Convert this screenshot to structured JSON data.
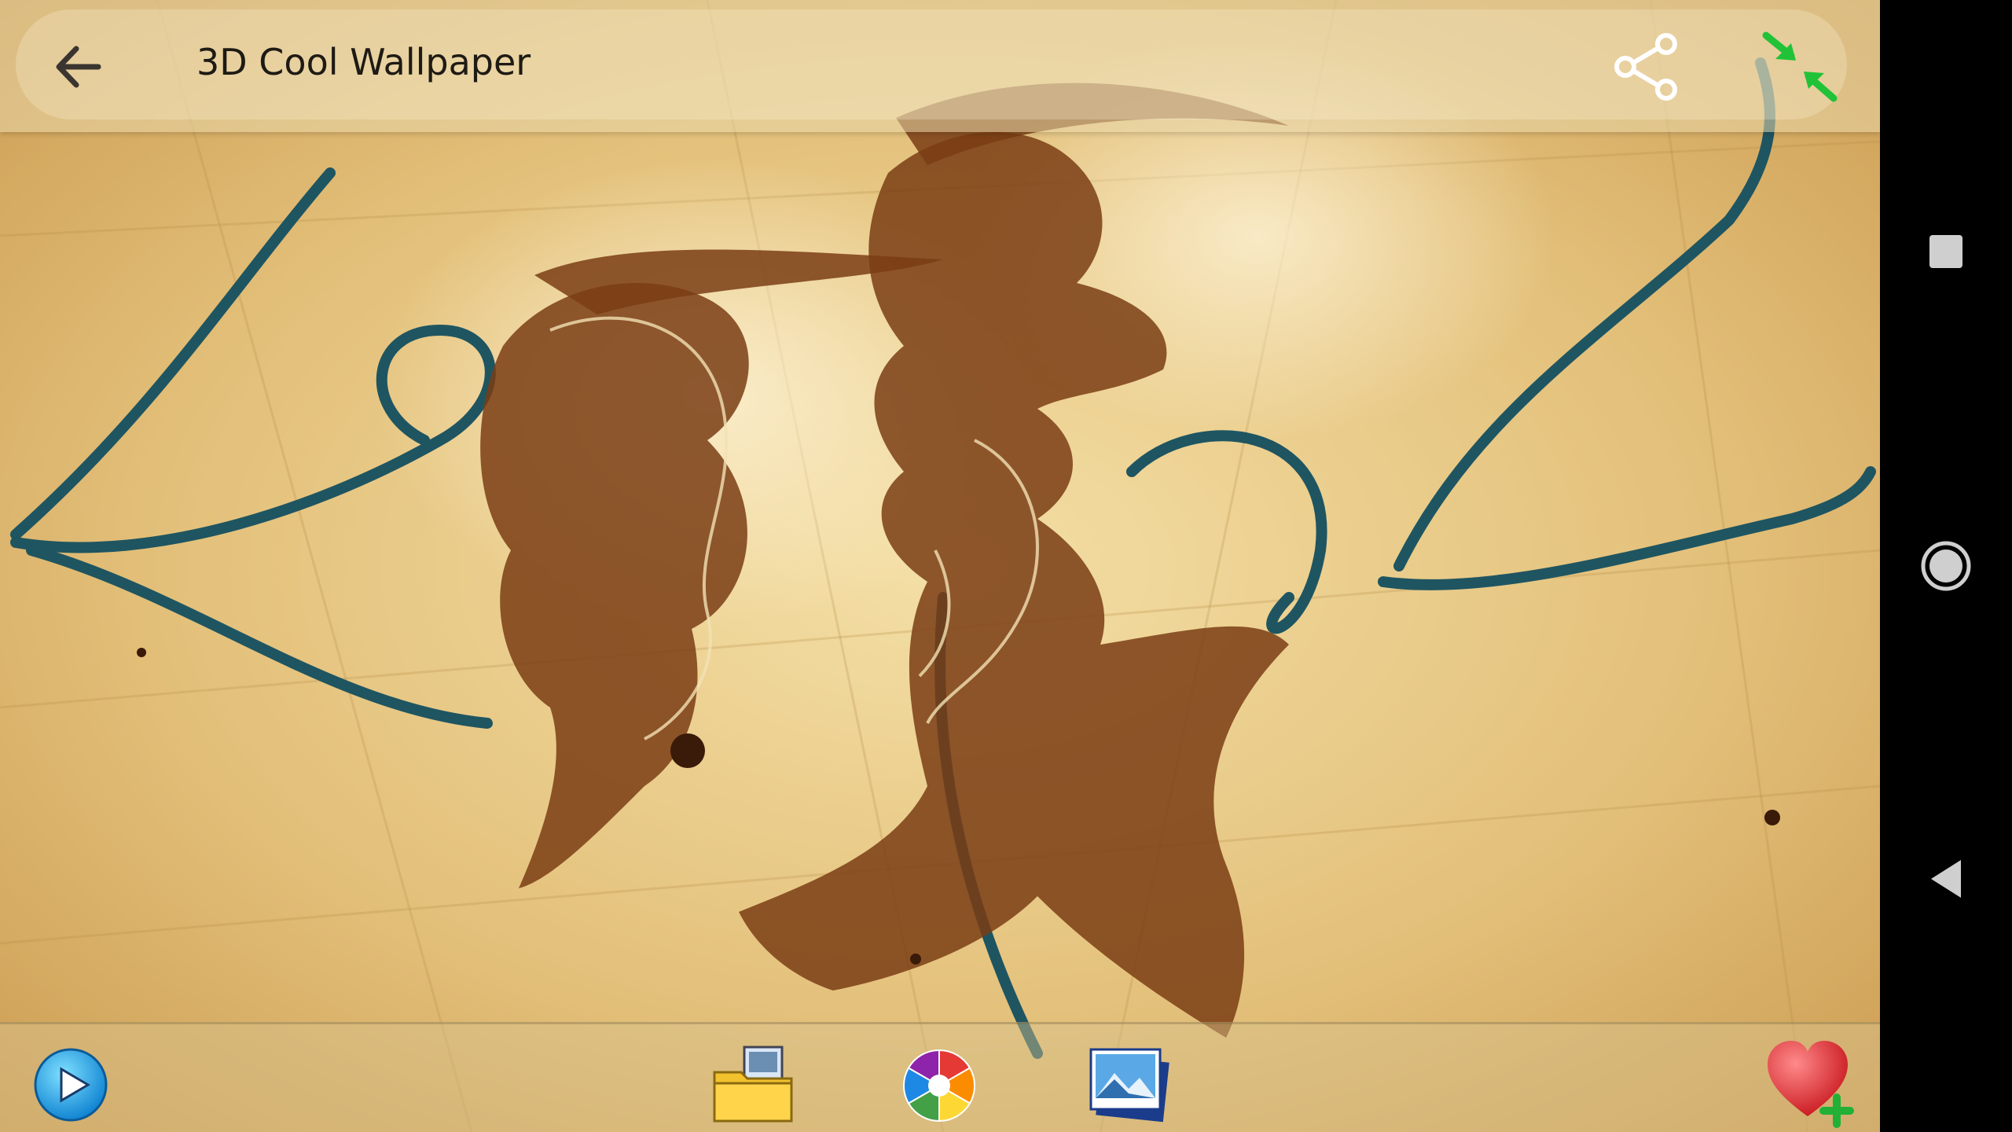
{
  "toolbar": {
    "title": "3D Cool Wallpaper",
    "back_icon": "arrow-left-icon",
    "share_icon": "share-icon",
    "fullscreen_icon": "exit-fullscreen-icon"
  },
  "wallpaper": {
    "description_icon": "wallpaper-artwork",
    "accent_colors": [
      "#e7c98a",
      "#7a3d14",
      "#1f5561"
    ]
  },
  "bottombar": {
    "items": [
      {
        "icon": "play-icon"
      },
      {
        "icon": "folder-icon"
      },
      {
        "icon": "color-wheel-icon"
      },
      {
        "icon": "gallery-icon"
      },
      {
        "icon": "favorite-add-icon"
      }
    ]
  },
  "navbar": {
    "items": [
      {
        "icon": "recents-icon"
      },
      {
        "icon": "home-icon"
      },
      {
        "icon": "back-icon"
      }
    ]
  }
}
